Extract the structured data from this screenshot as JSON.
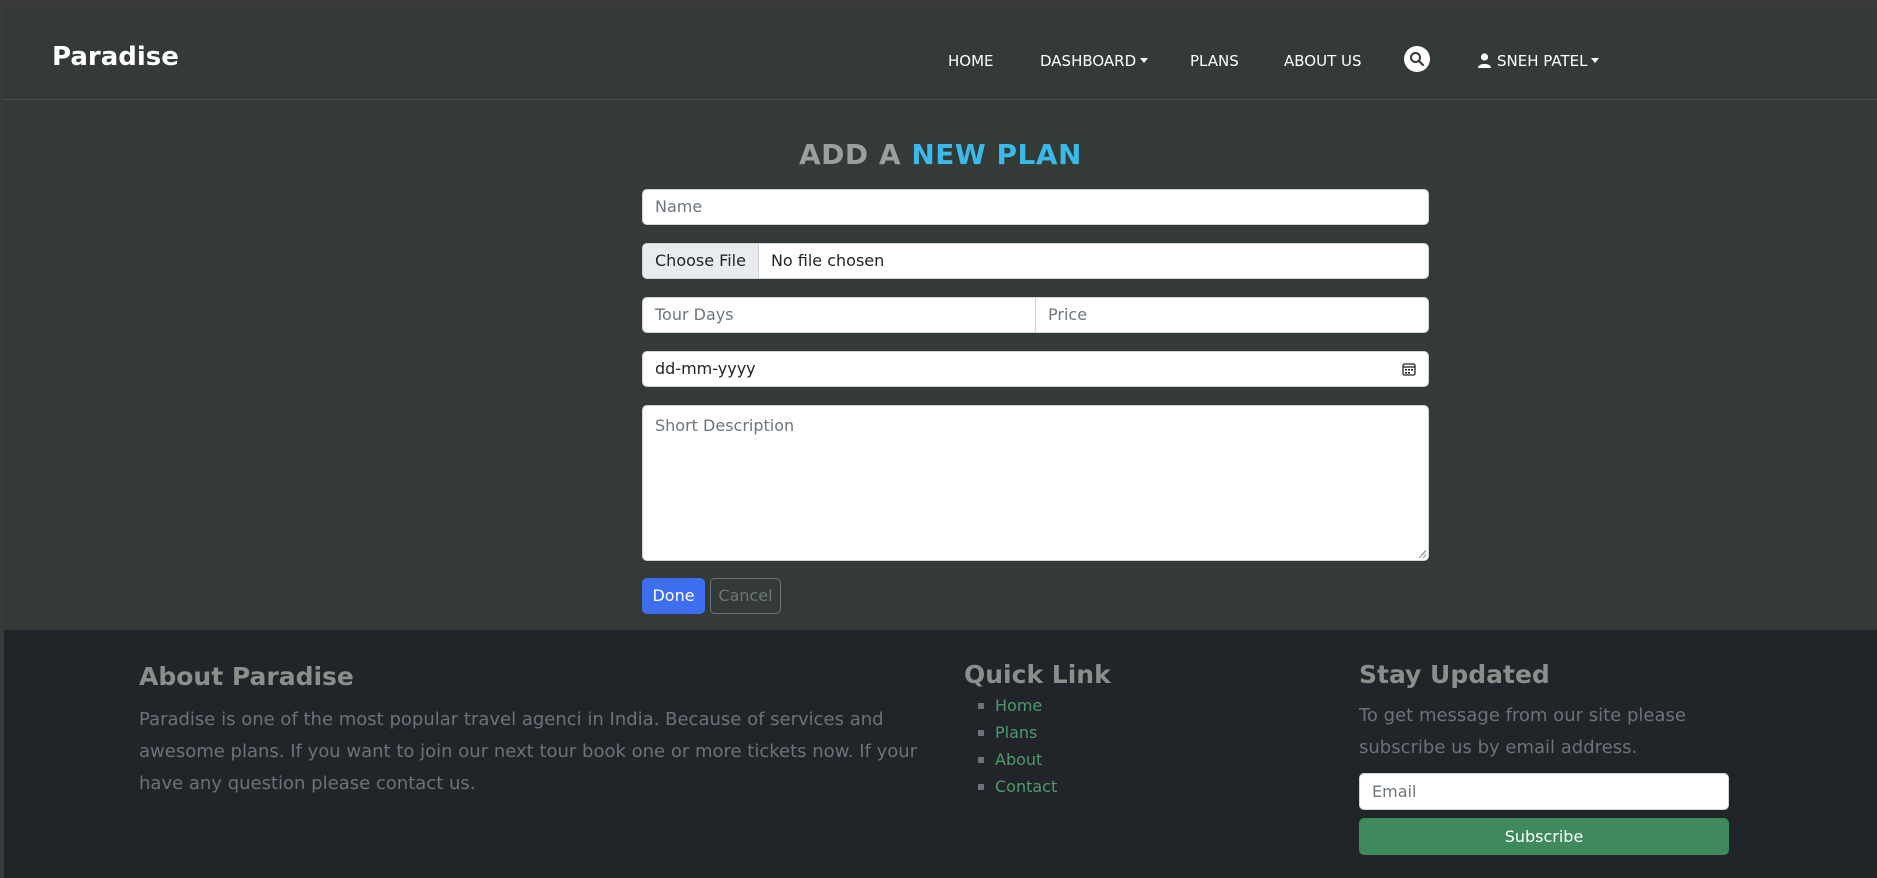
{
  "nav": {
    "brand": "Paradise",
    "home": "HOME",
    "dashboard": "DASHBOARD",
    "plans": "PLANS",
    "about": "ABOUT US",
    "user": "SNEH PATEL"
  },
  "form": {
    "title_part1": "ADD A",
    "title_part2": "NEW PLAN",
    "name_placeholder": "Name",
    "file_button": "Choose File",
    "file_status": "No file chosen",
    "tour_days_placeholder": "Tour Days",
    "price_placeholder": "Price",
    "date_value": "dd-mm-yyyy",
    "description_placeholder": "Short Description",
    "done_label": "Done",
    "cancel_label": "Cancel"
  },
  "footer": {
    "about_title": "About Paradise",
    "about_text": "Paradise is one of the most popular travel agenci in India. Because of services and awesome plans. If you want to join our next tour book one or more tickets now. If your have any question please contact us.",
    "quick_title": "Quick Link",
    "quick_links": [
      "Home",
      "Plans",
      "About",
      "Contact"
    ],
    "stay_title": "Stay Updated",
    "stay_text": "To get message from our site please subscribe us by email address.",
    "email_placeholder": "Email",
    "subscribe_label": "Subscribe"
  },
  "colors": {
    "background": "#343a35",
    "footer": "#212529",
    "accent_blue": "#3bb9ea",
    "primary_button": "#3d6ff0",
    "subscribe_button": "#3e8a5d",
    "link_green": "#4f9a6c"
  },
  "icons": [
    "search-icon",
    "user-icon",
    "calendar-icon",
    "caret-down-icon"
  ]
}
